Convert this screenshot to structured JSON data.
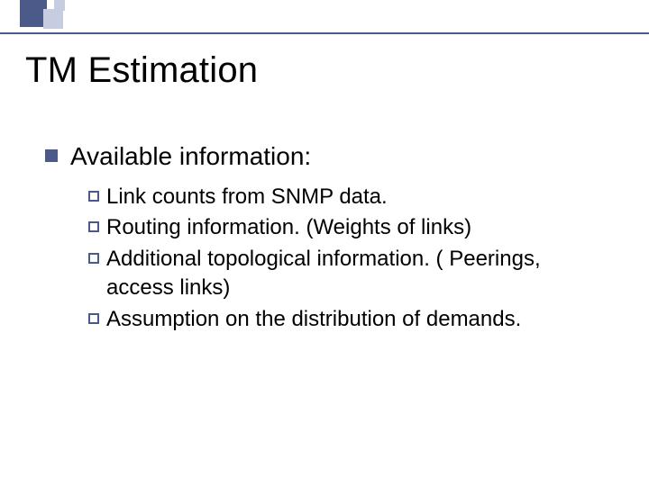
{
  "slide": {
    "title": "TM Estimation",
    "bullet": {
      "text": "Available information:",
      "subs": [
        "Link counts from SNMP data.",
        "Routing information. (Weights of links)",
        "Additional topological information. ( Peerings, access links)",
        "Assumption on the distribution of demands."
      ]
    }
  }
}
